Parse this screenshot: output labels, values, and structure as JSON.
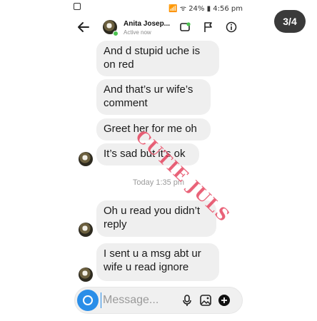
{
  "status_bar": {
    "right_text": "📶 ᯤ 24% ▮ 4:56 pm"
  },
  "header": {
    "back_icon": "arrow-left-icon",
    "contact_name": "Anita Josep...",
    "contact_status": "Active now",
    "icons": [
      "video-call-icon",
      "flag-icon",
      "info-icon"
    ]
  },
  "page_badge": "3/4",
  "messages": [
    {
      "text": "And d stupid uche is on red"
    },
    {
      "text": "And that’s ur wife’s comment"
    },
    {
      "text": "Greet her for me oh"
    },
    {
      "text": "It’s sad but it’s ok"
    },
    {
      "text": "Oh u read you didn’t reply"
    },
    {
      "text": "I sent u a msg abt ur wife u read ignore"
    }
  ],
  "timestamp": "Today 1:35 pm",
  "watermark": "CUTIE JULS",
  "composer": {
    "placeholder": "Message...",
    "icons": [
      "camera-icon",
      "microphone-icon",
      "gallery-icon",
      "add-icon"
    ]
  },
  "colors": {
    "accent": "#2a8ee8",
    "bubble": "#efefef",
    "online": "#4bc24f",
    "watermark": "#e12d4b"
  }
}
